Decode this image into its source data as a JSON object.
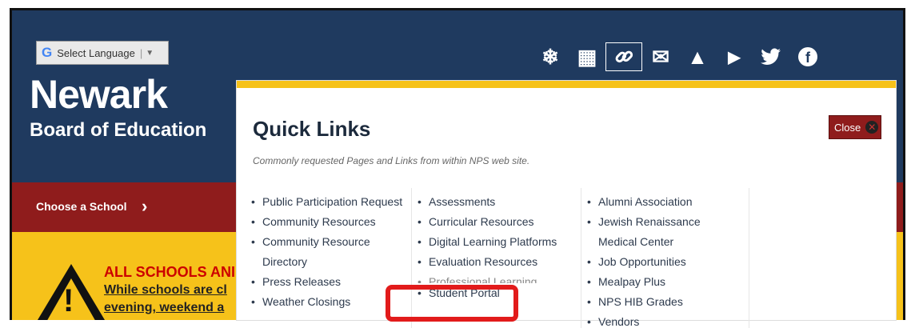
{
  "translate": {
    "g": "G",
    "label": "Select Language",
    "arrow": "▼"
  },
  "site": {
    "title": "Newark",
    "subtitle": "Board of Education"
  },
  "header_icons": [
    {
      "name": "snowflake-icon",
      "glyph": "❄"
    },
    {
      "name": "calendar-icon",
      "glyph": "▦"
    },
    {
      "name": "link-icon",
      "glyph": "🔗"
    },
    {
      "name": "mail-icon",
      "glyph": "✉"
    },
    {
      "name": "drive-icon",
      "glyph": "▲"
    },
    {
      "name": "youtube-icon",
      "glyph": "▶"
    },
    {
      "name": "twitter-icon",
      "glyph": "🐦"
    },
    {
      "name": "facebook-icon",
      "glyph": "f"
    }
  ],
  "school_bar": {
    "label": "Choose a School",
    "chevron": "›"
  },
  "alert": {
    "heading": "ALL SCHOOLS ANI",
    "line1": "While schools are cl",
    "line2": "evening, weekend a"
  },
  "quick_links": {
    "title": "Quick Links",
    "subtitle": "Commonly requested Pages and Links from within NPS web site.",
    "close_label": "Close",
    "close_glyph": "✕",
    "col1": [
      {
        "text": "Public Participation Request"
      },
      {
        "text": "Community Resources"
      },
      {
        "text": "Community Resource"
      },
      {
        "text": "Directory",
        "cont": true
      },
      {
        "text": "Press Releases"
      },
      {
        "text": "Weather Closings"
      }
    ],
    "col2": [
      {
        "text": "Assessments"
      },
      {
        "text": "Curricular Resources"
      },
      {
        "text": "Digital Learning Platforms"
      },
      {
        "text": "Evaluation Resources"
      },
      {
        "text": "Professional Learning",
        "cut": true
      },
      {
        "text": "Student Portal"
      }
    ],
    "col3": [
      {
        "text": "Alumni Association"
      },
      {
        "text": "Jewish Renaissance"
      },
      {
        "text": "Medical Center",
        "cont": true
      },
      {
        "text": "Job Opportunities"
      },
      {
        "text": "Mealpay Plus"
      },
      {
        "text": "NPS HIB Grades"
      },
      {
        "text": "Vendors"
      }
    ]
  },
  "colors": {
    "header": "#1f3a5f",
    "school_bar": "#8f1c1c",
    "alert": "#f6c21a",
    "highlight": "#e21b1b"
  }
}
